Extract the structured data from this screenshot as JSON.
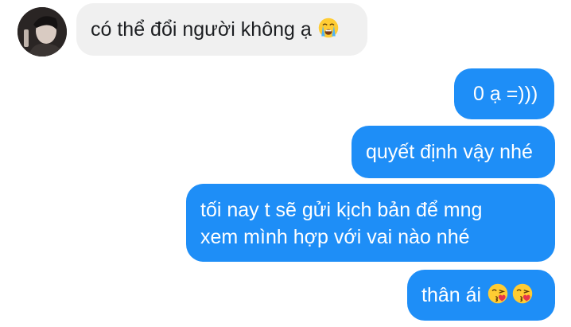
{
  "messages": {
    "incoming_text": "có thể đổi người không ạ",
    "incoming_emoji": "loudly-crying-face",
    "out1": "0 ạ =)))",
    "out2": "quyết định vậy nhé",
    "out3_line1": "tối nay t sẽ gửi kịch bản để mng",
    "out3_line2": "xem mình hợp với vai nào nhé",
    "out4_text": "thân ái",
    "out4_emoji": "face-blowing-a-kiss"
  },
  "colors": {
    "outgoing_bubble": "#1e8ef7",
    "incoming_bubble": "#f0f0f0"
  }
}
